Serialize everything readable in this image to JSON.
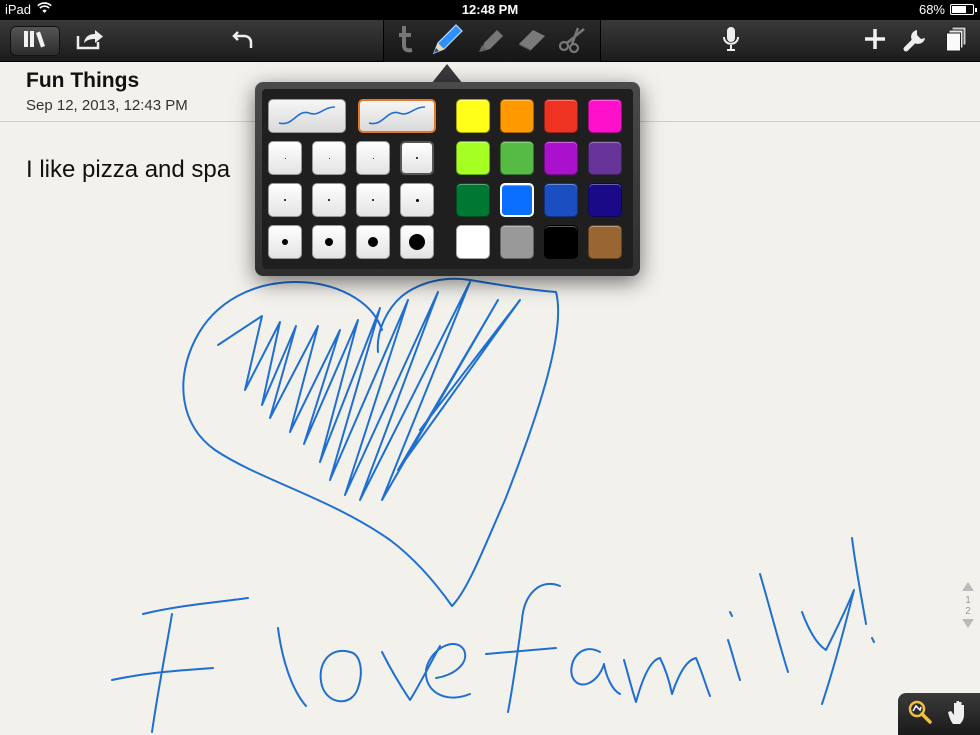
{
  "status_bar": {
    "device": "iPad",
    "time": "12:48 PM",
    "battery_label": "68%",
    "battery_level": 0.68
  },
  "toolbar": {
    "left": [
      "books-icon",
      "share-icon",
      "undo-icon"
    ],
    "tools": [
      "text-tool-icon",
      "pen-tool-icon",
      "highlighter-tool-icon",
      "eraser-tool-icon",
      "scissors-tool-icon"
    ],
    "active_tool": "pen-tool-icon",
    "right": [
      "microphone-icon",
      "add-icon",
      "wrench-icon",
      "pages-icon"
    ]
  },
  "note": {
    "title": "Fun Things",
    "date": "Sep 12, 2013, 12:43 PM",
    "body": "I like pizza and spa"
  },
  "pen_popover": {
    "smoothing_options": [
      "smooth-curve",
      "smooth-curve"
    ],
    "selected_smoothing": 1,
    "sizes": [
      1,
      1,
      1,
      2,
      2,
      2,
      2,
      3,
      6,
      8,
      10,
      16
    ],
    "selected_size": 3,
    "colors": [
      "#ffff1a",
      "#ff9900",
      "#ee3322",
      "#ff11cc",
      "#a6ff22",
      "#55bb44",
      "#aa11cc",
      "#663399",
      "#007733",
      "#0a6fff",
      "#1b4ec1",
      "#1a0a88",
      "#ffffff",
      "#999999",
      "#000000",
      "#996633"
    ],
    "selected_color": "#0a6fff"
  },
  "ink_color": "#1f6fd1",
  "handwriting": "I love family!",
  "page_nav": {
    "pages": [
      "1",
      "2"
    ]
  },
  "bottom_tools": [
    "zoom-icon",
    "hand-icon"
  ]
}
